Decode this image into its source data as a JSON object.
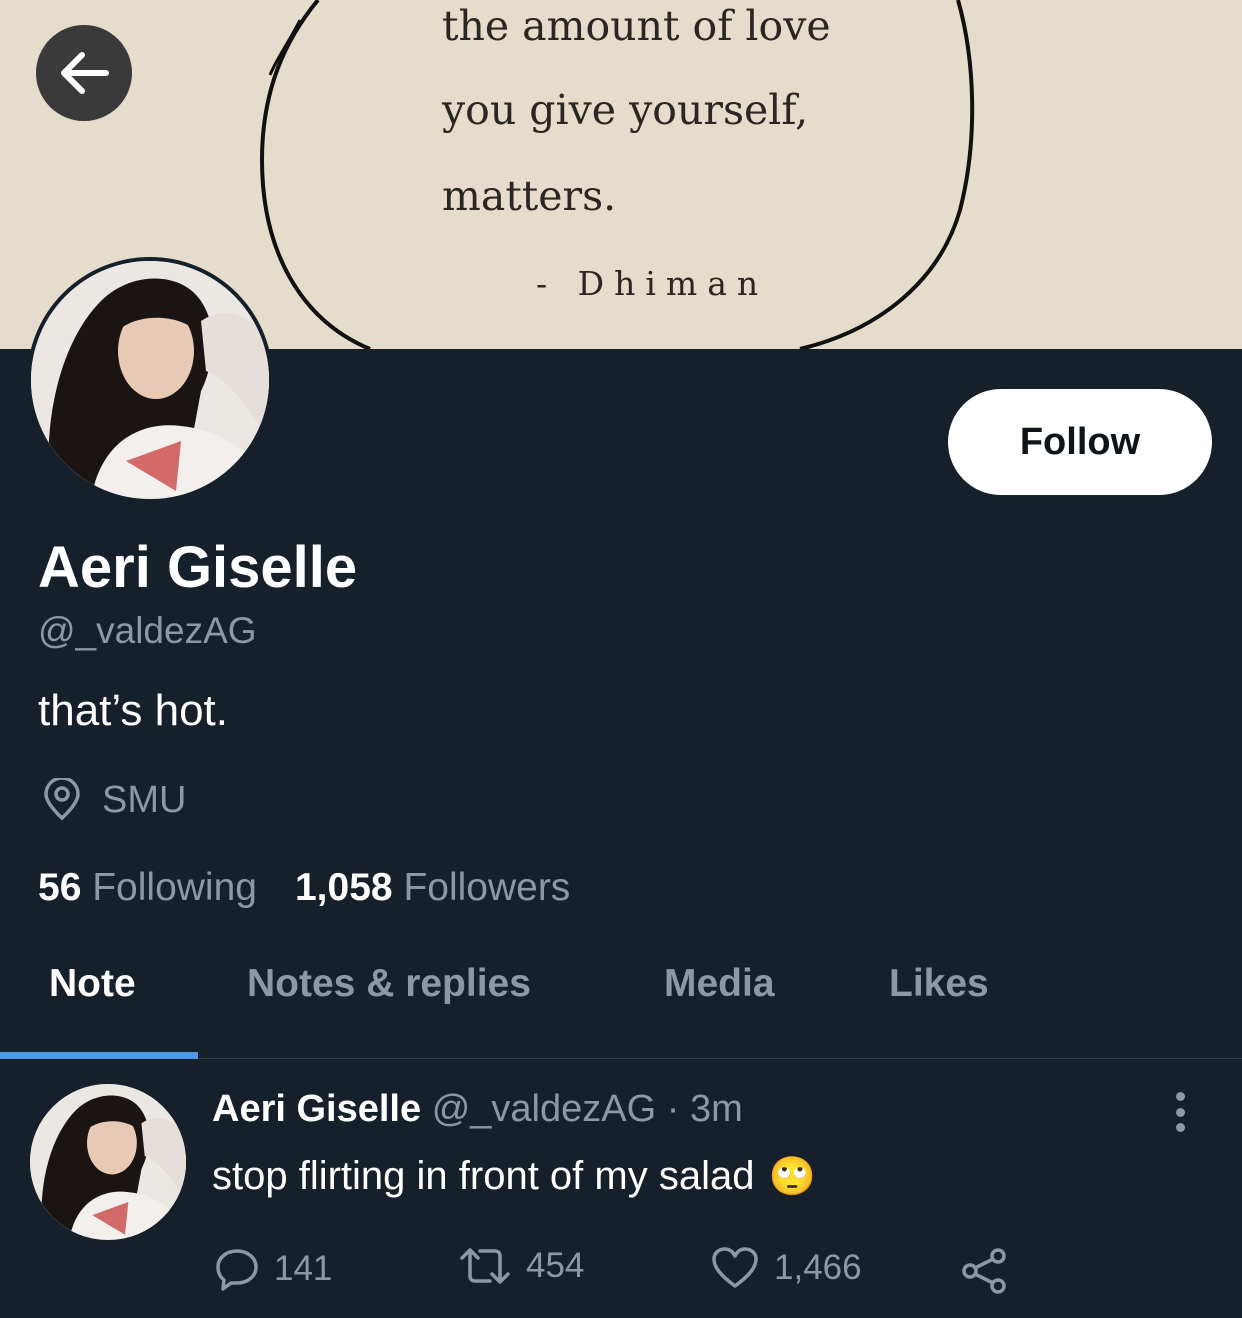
{
  "banner": {
    "quote_lines": [
      "the amount of love",
      "you give yourself,",
      "matters."
    ],
    "attribution": "- Dhiman"
  },
  "profile": {
    "name": "Aeri Giselle",
    "handle": "@_valdezAG",
    "bio": "that’s hot.",
    "location": "SMU",
    "following_count": "56",
    "following_label": "Following",
    "followers_count": "1,058",
    "followers_label": "Followers",
    "follow_button": "Follow"
  },
  "tabs": [
    {
      "label": "Note",
      "active": true
    },
    {
      "label": "Notes & replies",
      "active": false
    },
    {
      "label": "Media",
      "active": false
    },
    {
      "label": "Likes",
      "active": false
    }
  ],
  "tweet": {
    "name": "Aeri Giselle",
    "handle": "@_valdezAG",
    "separator": "·",
    "time": "3m",
    "text": "stop flirting in front of my salad",
    "emoji": "🙄",
    "replies": "141",
    "retweets": "454",
    "likes": "1,466"
  },
  "colors": {
    "background": "#15202b",
    "accent": "#4a99e9",
    "secondary_text": "#8b98a5",
    "banner": "#e5dccb"
  },
  "icons": [
    "back-arrow-icon",
    "location-pin-icon",
    "reply-icon",
    "retweet-icon",
    "like-icon",
    "share-icon",
    "more-options-icon"
  ]
}
